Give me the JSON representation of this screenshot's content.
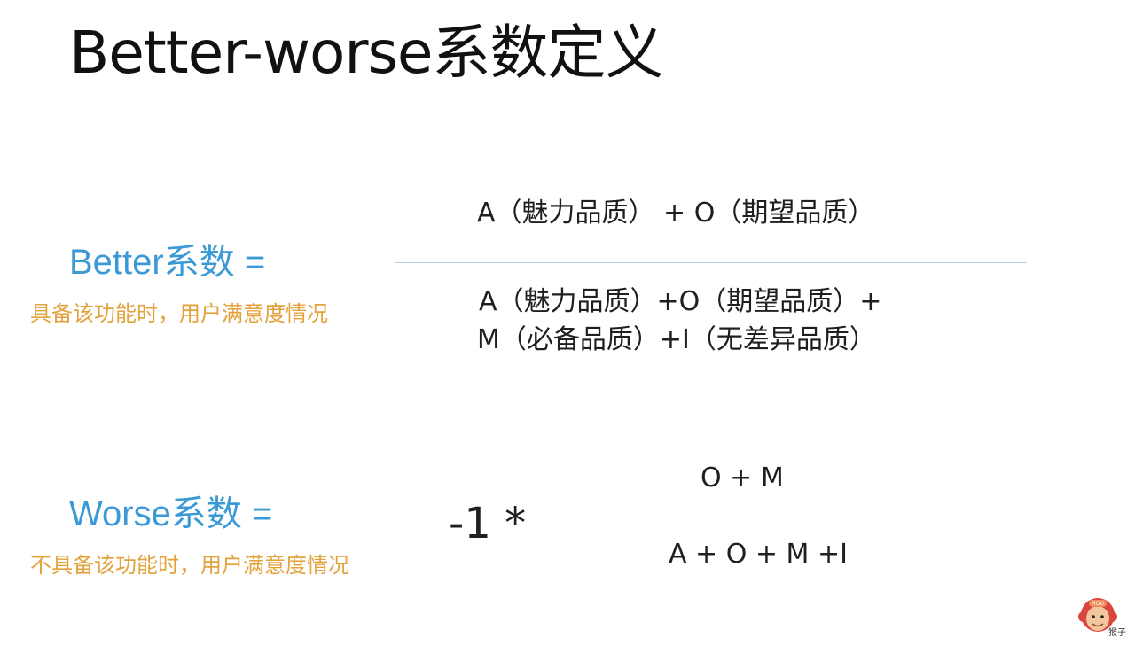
{
  "title": "Better-worse系数定义",
  "colors": {
    "label_blue": "#3b9ad6",
    "desc_orange": "#e3a23c",
    "fraction_line": "#a9d3ee",
    "text": "#1f1f1f"
  },
  "better": {
    "label": "Better系数 =",
    "description": "具备该功能时，用户满意度情况",
    "numerator": "A（魅力品质） + O（期望品质）",
    "denominator_line1": "A（魅力品质）+O（期望品质）+",
    "denominator_line2": "M（必备品质）+I（无差异品质）"
  },
  "worse": {
    "label": "Worse系数 =",
    "description": "不具备该功能时，用户满意度情况",
    "multiplier": "-1 *",
    "numerator": "O +  M",
    "denominator": "A + O + M +I"
  },
  "watermark": {
    "icon": "monkey-face-icon",
    "badge_text": "HOU",
    "label": "猴子"
  }
}
